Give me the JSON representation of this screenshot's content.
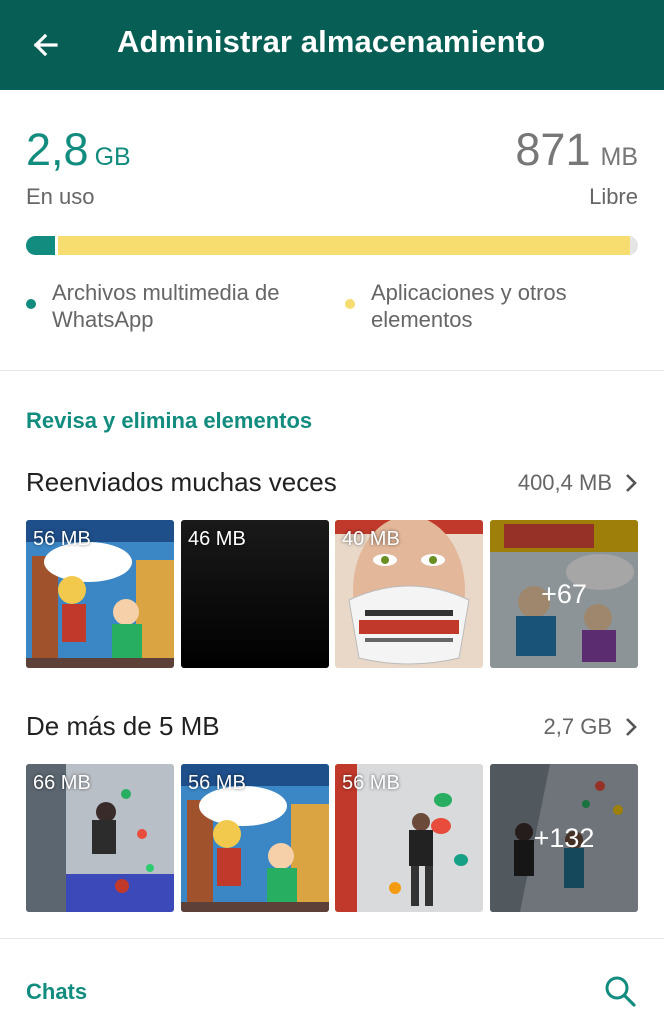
{
  "appbar": {
    "title": "Administrar almacenamiento",
    "back_icon": "arrow-left-icon",
    "color": "#075e54"
  },
  "usage": {
    "used_value": "2,8",
    "used_unit": "GB",
    "used_label": "En uso",
    "free_value": "871",
    "free_unit": "MB",
    "free_label": "Libre",
    "whatsapp_fraction": 0.047,
    "apps_fraction": 0.935,
    "legend": [
      {
        "label": "Archivos multimedia de WhatsApp",
        "color": "#128c7e"
      },
      {
        "label": "Aplicaciones y otros elementos",
        "color": "#f7dc6f"
      }
    ]
  },
  "review": {
    "title": "Revisa y elimina elementos",
    "forwarded": {
      "title": "Reenviados muchas veces",
      "size": "400,4 MB",
      "items": [
        {
          "label": "56 MB",
          "kind": "comic"
        },
        {
          "label": "46 MB",
          "kind": "black"
        },
        {
          "label": "40 MB",
          "kind": "magazine"
        },
        {
          "label": "+67",
          "kind": "comic-more"
        }
      ]
    },
    "large": {
      "title": "De más de 5 MB",
      "size": "2,7 GB",
      "items": [
        {
          "label": "66 MB",
          "kind": "climbing"
        },
        {
          "label": "56 MB",
          "kind": "comic"
        },
        {
          "label": "56 MB",
          "kind": "climbing"
        },
        {
          "label": "+132",
          "kind": "climbing-more"
        }
      ]
    }
  },
  "chats": {
    "title": "Chats",
    "search_icon": "search-icon"
  }
}
